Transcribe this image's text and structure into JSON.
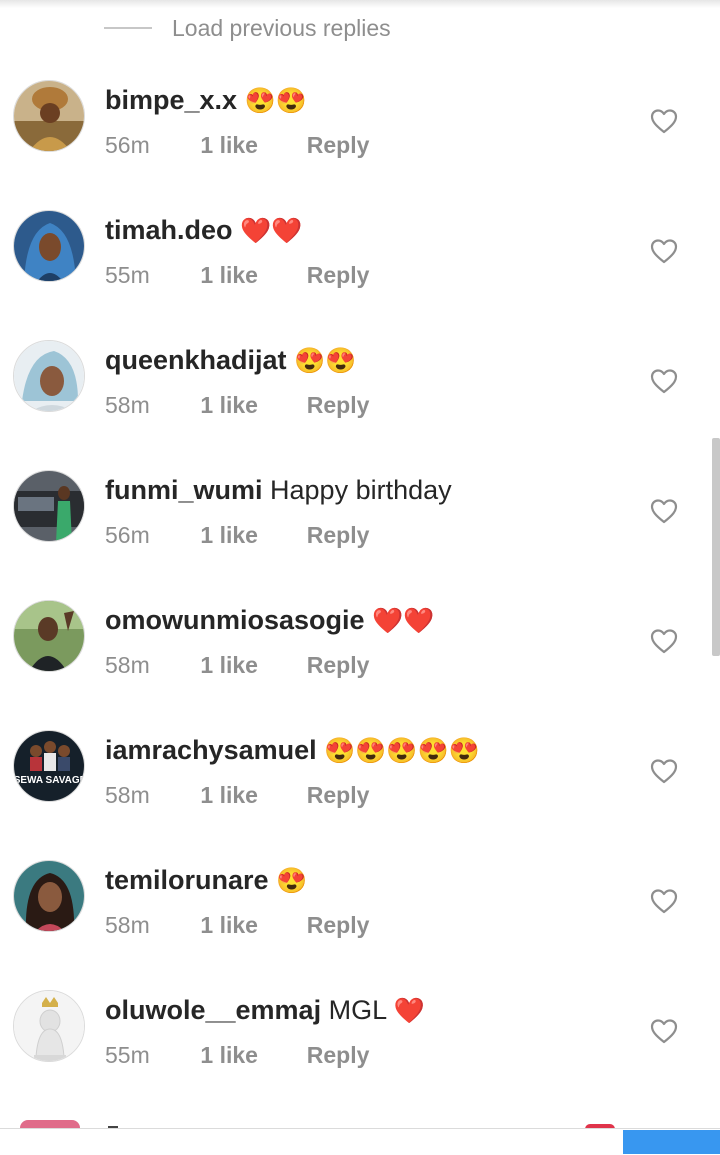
{
  "load_previous": {
    "label": "Load previous replies"
  },
  "comments": [
    {
      "username": "bimpe_x.x",
      "text": "",
      "emojis": "😍😍",
      "time": "56m",
      "likes": "1 like",
      "reply": "Reply",
      "avatar": "avatar-woman-headwrap"
    },
    {
      "username": "timah.deo",
      "text": "",
      "emojis": "❤️❤️",
      "time": "55m",
      "likes": "1 like",
      "reply": "Reply",
      "avatar": "avatar-woman-hijab"
    },
    {
      "username": "queenkhadijat",
      "text": "",
      "emojis": "😍😍",
      "time": "58m",
      "likes": "1 like",
      "reply": "Reply",
      "avatar": "avatar-woman-light"
    },
    {
      "username": "funmi_wumi",
      "text": "Happy birthday",
      "emojis": "",
      "time": "56m",
      "likes": "1 like",
      "reply": "Reply",
      "avatar": "avatar-woman-car"
    },
    {
      "username": "omowunmiosasogie",
      "text": "",
      "emojis": "❤️❤️",
      "time": "58m",
      "likes": "1 like",
      "reply": "Reply",
      "avatar": "avatar-woman-outdoor"
    },
    {
      "username": "iamrachysamuel",
      "text": "",
      "emojis": "😍😍😍😍😍",
      "time": "58m",
      "likes": "1 like",
      "reply": "Reply",
      "avatar": "avatar-movie-poster",
      "avatar_text": "SEWA SAVAGE"
    },
    {
      "username": "temilorunare",
      "text": "",
      "emojis": "😍",
      "time": "58m",
      "likes": "1 like",
      "reply": "Reply",
      "avatar": "avatar-woman-portrait"
    },
    {
      "username": "oluwole__emmaj",
      "text": "MGL",
      "emojis": "❤️",
      "time": "55m",
      "likes": "1 like",
      "reply": "Reply",
      "avatar": "avatar-lion-statue"
    }
  ],
  "colors": {
    "username": "#262626",
    "meta": "#8e8e8e",
    "accent": "#3897f0",
    "heart_outline": "#8e8e8e"
  },
  "icons": {
    "like": "heart-outline-icon"
  }
}
